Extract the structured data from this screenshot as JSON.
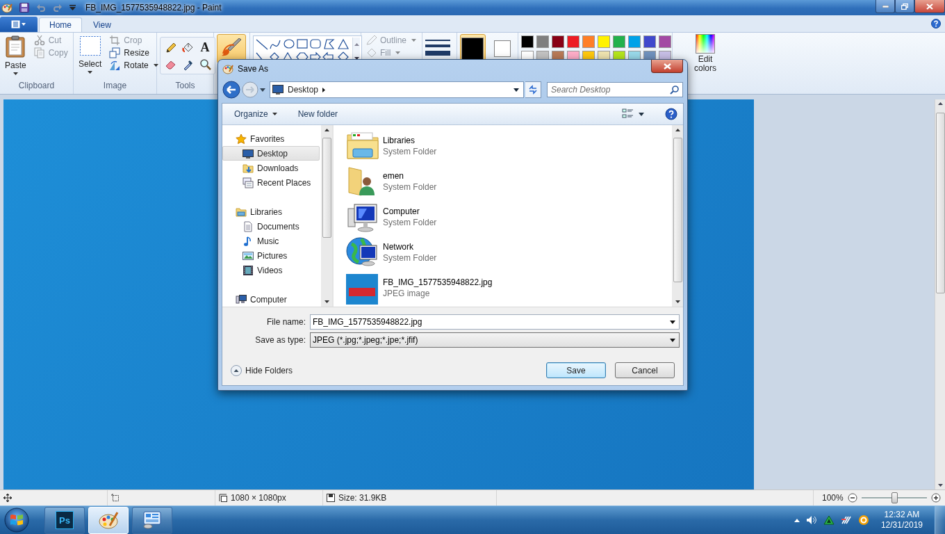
{
  "app_window": {
    "title": "FB_IMG_1577535948822.jpg - Paint"
  },
  "ribbon": {
    "tabs": [
      {
        "label": "Home",
        "selected": true
      },
      {
        "label": "View",
        "selected": false
      }
    ],
    "clipboard": {
      "label": "Clipboard",
      "paste": "Paste",
      "items": [
        {
          "label": "Cut",
          "disabled": true
        },
        {
          "label": "Copy",
          "disabled": true
        }
      ]
    },
    "image": {
      "label": "Image",
      "select": "Select",
      "items": [
        {
          "label": "Crop",
          "disabled": true
        },
        {
          "label": "Resize",
          "disabled": false
        },
        {
          "label": "Rotate",
          "disabled": false
        }
      ]
    },
    "tools": {
      "label": "Tools",
      "text_tool": "A"
    },
    "brush_tool": {
      "selected": true
    },
    "shape_style": [
      {
        "label": "Outline",
        "disabled": true
      },
      {
        "label": "Fill",
        "disabled": true
      }
    ],
    "current_colors": [
      {
        "color": "#000000",
        "selected": true
      },
      {
        "color": "#ffffff",
        "selected": false
      }
    ],
    "palette": [
      {
        "color": "#000000"
      },
      {
        "color": "#7f7f7f"
      },
      {
        "color": "#880015"
      },
      {
        "color": "#ed1c24"
      },
      {
        "color": "#ff7f27"
      },
      {
        "color": "#fff200"
      },
      {
        "color": "#22b14c"
      },
      {
        "color": "#00a2e8"
      },
      {
        "color": "#3f48cc"
      },
      {
        "color": "#a349a4"
      },
      {
        "color": "#ffffff"
      },
      {
        "color": "#c3c3c3"
      },
      {
        "color": "#b97a57"
      },
      {
        "color": "#ffaec9"
      },
      {
        "color": "#ffc90e"
      },
      {
        "color": "#efe4b0"
      },
      {
        "color": "#b5e61d"
      },
      {
        "color": "#99d9ea"
      },
      {
        "color": "#7092be"
      },
      {
        "color": "#c8bfe7"
      }
    ],
    "edit_colors": "Edit colors"
  },
  "status_bar": {
    "dimensions": "1080 × 1080px",
    "file_size": "Size: 31.9KB",
    "zoom": "100%",
    "zoom_slider": {
      "level": 0.5
    }
  },
  "dialog": {
    "title": "Save As",
    "breadcrumb": "Desktop",
    "search": {
      "placeholder": "Search Desktop"
    },
    "toolbar": [
      {
        "label": "Organize",
        "kind": "menu"
      },
      {
        "label": "New folder",
        "kind": "button"
      }
    ],
    "nav": [
      {
        "label": "Favorites",
        "kind": "star",
        "selected": false,
        "children": [
          {
            "label": "Desktop",
            "kind": "desktop",
            "selected": true
          },
          {
            "label": "Downloads",
            "kind": "downloads",
            "selected": false
          },
          {
            "label": "Recent Places",
            "kind": "recent",
            "selected": false
          }
        ]
      },
      {
        "label": "Libraries",
        "kind": "libraries",
        "selected": false,
        "children": [
          {
            "label": "Documents",
            "kind": "documents",
            "selected": false
          },
          {
            "label": "Music",
            "kind": "music",
            "selected": false
          },
          {
            "label": "Pictures",
            "kind": "pictures",
            "selected": false
          },
          {
            "label": "Videos",
            "kind": "videos",
            "selected": false
          }
        ]
      },
      {
        "label": "Computer",
        "kind": "computer",
        "selected": false
      }
    ],
    "items": [
      {
        "name": "Libraries",
        "type": "System Folder",
        "kind": "libraries"
      },
      {
        "name": "emen",
        "type": "System Folder",
        "kind": "user"
      },
      {
        "name": "Computer",
        "type": "System Folder",
        "kind": "computer"
      },
      {
        "name": "Network",
        "type": "System Folder",
        "kind": "network"
      },
      {
        "name": "FB_IMG_1577535948822.jpg",
        "type": "JPEG image",
        "kind": "image"
      }
    ],
    "file_name": {
      "label": "File name:",
      "value": "FB_IMG_1577535948822.jpg"
    },
    "save_type": {
      "label": "Save as type:",
      "value": "JPEG (*.jpg;*.jpeg;*.jpe;*.jfif)"
    },
    "hide_folders": "Hide Folders",
    "buttons": [
      {
        "label": "Save",
        "kind": "default"
      },
      {
        "label": "Cancel",
        "kind": "normal"
      }
    ]
  },
  "taskbar": {
    "apps": [
      {
        "kind": "photoshop",
        "label": "Ps",
        "selected": false
      },
      {
        "kind": "paint",
        "selected": true
      },
      {
        "kind": "dashboard",
        "selected": false
      }
    ],
    "time": "12:32 AM",
    "date": "12/31/2019"
  }
}
